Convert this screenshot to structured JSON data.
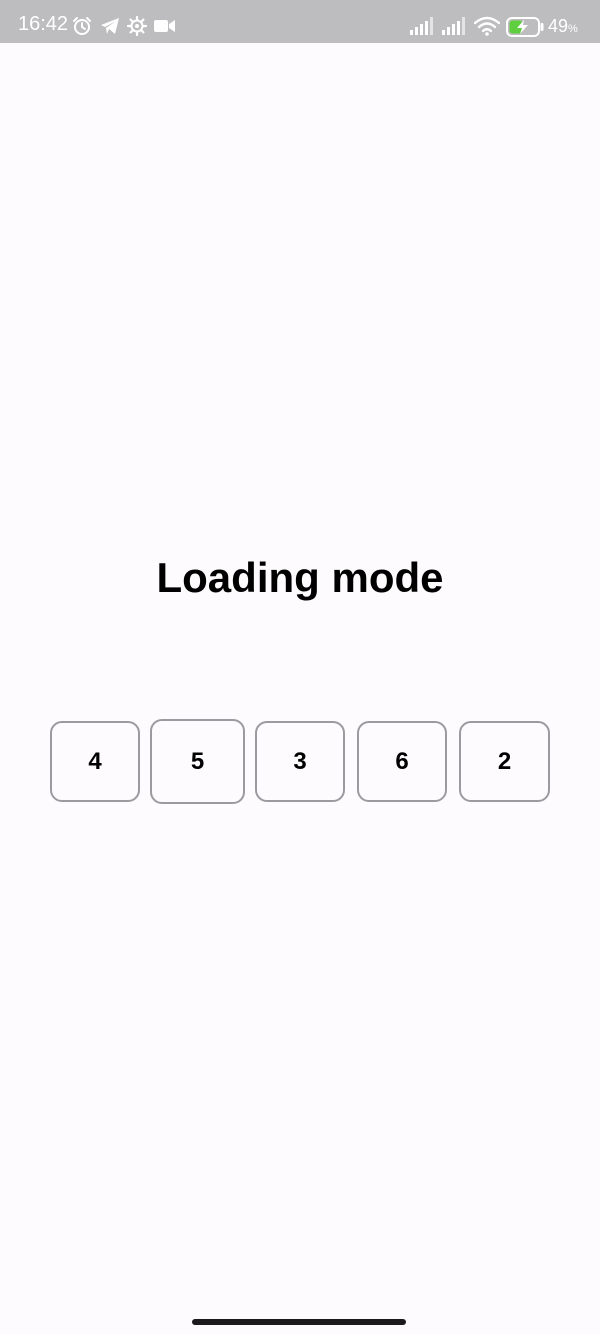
{
  "status_bar": {
    "time": "16:42",
    "battery_percent": "49",
    "battery_percent_sign": "%",
    "left_icons": [
      "alarm-icon",
      "telegram-icon",
      "settings-icon",
      "video-camera-icon"
    ],
    "right_icons": [
      "signal-icon",
      "signal-icon",
      "wifi-icon",
      "battery-charging-icon"
    ],
    "battery_level": 0.49,
    "battery_fill_color": "#5fcf3f"
  },
  "main": {
    "title": "Loading mode",
    "digits": [
      "4",
      "5",
      "3",
      "6",
      "2"
    ]
  },
  "colors": {
    "background": "#fdfbfd",
    "status_bar": "#bdbcbe",
    "box_border": "#9c9a9e",
    "text": "#000000"
  }
}
